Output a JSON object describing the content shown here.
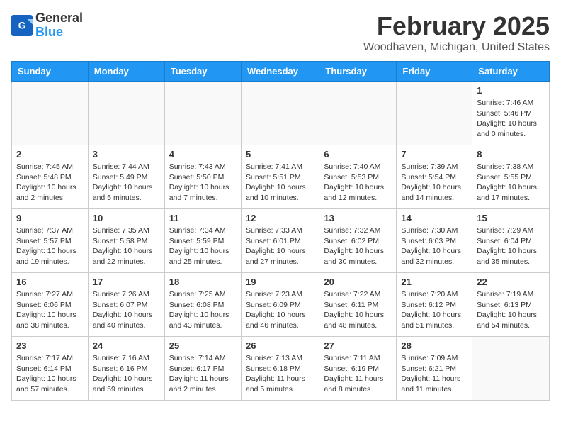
{
  "header": {
    "logo_general": "General",
    "logo_blue": "Blue",
    "title": "February 2025",
    "location": "Woodhaven, Michigan, United States"
  },
  "columns": [
    "Sunday",
    "Monday",
    "Tuesday",
    "Wednesday",
    "Thursday",
    "Friday",
    "Saturday"
  ],
  "weeks": [
    [
      {
        "day": "",
        "info": ""
      },
      {
        "day": "",
        "info": ""
      },
      {
        "day": "",
        "info": ""
      },
      {
        "day": "",
        "info": ""
      },
      {
        "day": "",
        "info": ""
      },
      {
        "day": "",
        "info": ""
      },
      {
        "day": "1",
        "info": "Sunrise: 7:46 AM\nSunset: 5:46 PM\nDaylight: 10 hours\nand 0 minutes."
      }
    ],
    [
      {
        "day": "2",
        "info": "Sunrise: 7:45 AM\nSunset: 5:48 PM\nDaylight: 10 hours\nand 2 minutes."
      },
      {
        "day": "3",
        "info": "Sunrise: 7:44 AM\nSunset: 5:49 PM\nDaylight: 10 hours\nand 5 minutes."
      },
      {
        "day": "4",
        "info": "Sunrise: 7:43 AM\nSunset: 5:50 PM\nDaylight: 10 hours\nand 7 minutes."
      },
      {
        "day": "5",
        "info": "Sunrise: 7:41 AM\nSunset: 5:51 PM\nDaylight: 10 hours\nand 10 minutes."
      },
      {
        "day": "6",
        "info": "Sunrise: 7:40 AM\nSunset: 5:53 PM\nDaylight: 10 hours\nand 12 minutes."
      },
      {
        "day": "7",
        "info": "Sunrise: 7:39 AM\nSunset: 5:54 PM\nDaylight: 10 hours\nand 14 minutes."
      },
      {
        "day": "8",
        "info": "Sunrise: 7:38 AM\nSunset: 5:55 PM\nDaylight: 10 hours\nand 17 minutes."
      }
    ],
    [
      {
        "day": "9",
        "info": "Sunrise: 7:37 AM\nSunset: 5:57 PM\nDaylight: 10 hours\nand 19 minutes."
      },
      {
        "day": "10",
        "info": "Sunrise: 7:35 AM\nSunset: 5:58 PM\nDaylight: 10 hours\nand 22 minutes."
      },
      {
        "day": "11",
        "info": "Sunrise: 7:34 AM\nSunset: 5:59 PM\nDaylight: 10 hours\nand 25 minutes."
      },
      {
        "day": "12",
        "info": "Sunrise: 7:33 AM\nSunset: 6:01 PM\nDaylight: 10 hours\nand 27 minutes."
      },
      {
        "day": "13",
        "info": "Sunrise: 7:32 AM\nSunset: 6:02 PM\nDaylight: 10 hours\nand 30 minutes."
      },
      {
        "day": "14",
        "info": "Sunrise: 7:30 AM\nSunset: 6:03 PM\nDaylight: 10 hours\nand 32 minutes."
      },
      {
        "day": "15",
        "info": "Sunrise: 7:29 AM\nSunset: 6:04 PM\nDaylight: 10 hours\nand 35 minutes."
      }
    ],
    [
      {
        "day": "16",
        "info": "Sunrise: 7:27 AM\nSunset: 6:06 PM\nDaylight: 10 hours\nand 38 minutes."
      },
      {
        "day": "17",
        "info": "Sunrise: 7:26 AM\nSunset: 6:07 PM\nDaylight: 10 hours\nand 40 minutes."
      },
      {
        "day": "18",
        "info": "Sunrise: 7:25 AM\nSunset: 6:08 PM\nDaylight: 10 hours\nand 43 minutes."
      },
      {
        "day": "19",
        "info": "Sunrise: 7:23 AM\nSunset: 6:09 PM\nDaylight: 10 hours\nand 46 minutes."
      },
      {
        "day": "20",
        "info": "Sunrise: 7:22 AM\nSunset: 6:11 PM\nDaylight: 10 hours\nand 48 minutes."
      },
      {
        "day": "21",
        "info": "Sunrise: 7:20 AM\nSunset: 6:12 PM\nDaylight: 10 hours\nand 51 minutes."
      },
      {
        "day": "22",
        "info": "Sunrise: 7:19 AM\nSunset: 6:13 PM\nDaylight: 10 hours\nand 54 minutes."
      }
    ],
    [
      {
        "day": "23",
        "info": "Sunrise: 7:17 AM\nSunset: 6:14 PM\nDaylight: 10 hours\nand 57 minutes."
      },
      {
        "day": "24",
        "info": "Sunrise: 7:16 AM\nSunset: 6:16 PM\nDaylight: 10 hours\nand 59 minutes."
      },
      {
        "day": "25",
        "info": "Sunrise: 7:14 AM\nSunset: 6:17 PM\nDaylight: 11 hours\nand 2 minutes."
      },
      {
        "day": "26",
        "info": "Sunrise: 7:13 AM\nSunset: 6:18 PM\nDaylight: 11 hours\nand 5 minutes."
      },
      {
        "day": "27",
        "info": "Sunrise: 7:11 AM\nSunset: 6:19 PM\nDaylight: 11 hours\nand 8 minutes."
      },
      {
        "day": "28",
        "info": "Sunrise: 7:09 AM\nSunset: 6:21 PM\nDaylight: 11 hours\nand 11 minutes."
      },
      {
        "day": "",
        "info": ""
      }
    ]
  ]
}
